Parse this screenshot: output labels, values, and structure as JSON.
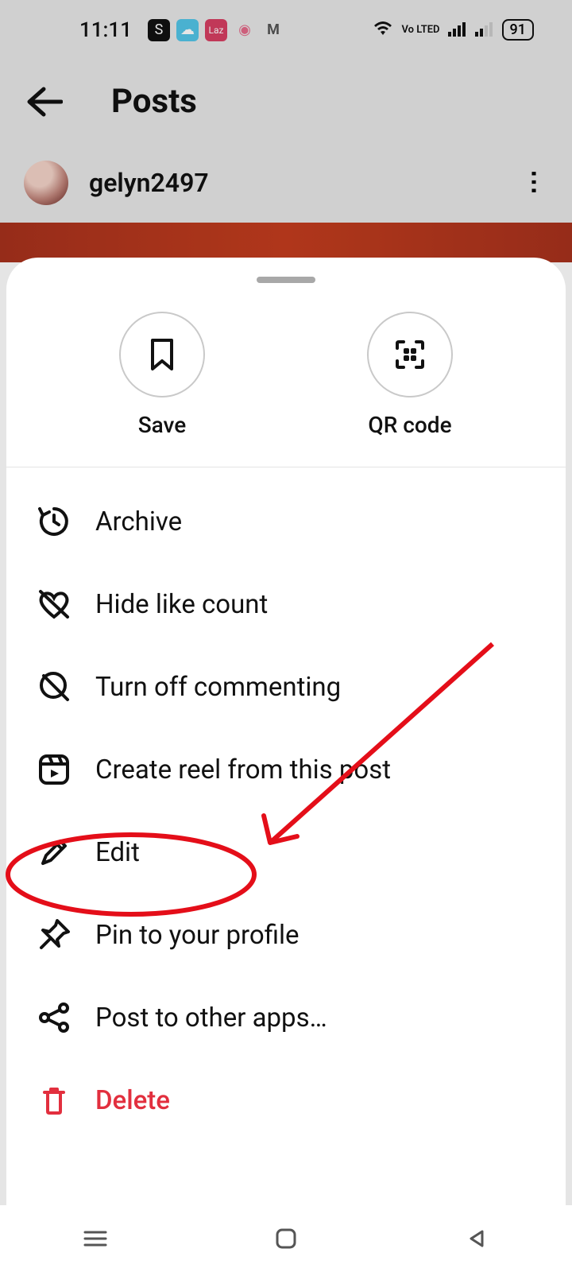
{
  "status": {
    "time": "11:11",
    "volte": "Vo LTED",
    "battery": "91"
  },
  "header": {
    "title": "Posts"
  },
  "user": {
    "name": "gelyn2497"
  },
  "sheet": {
    "top": [
      {
        "label": "Save"
      },
      {
        "label": "QR code"
      }
    ],
    "items": [
      {
        "label": "Archive"
      },
      {
        "label": "Hide like count"
      },
      {
        "label": "Turn off commenting"
      },
      {
        "label": "Create reel from this post"
      },
      {
        "label": "Edit"
      },
      {
        "label": "Pin to your profile"
      },
      {
        "label": "Post to other apps…"
      },
      {
        "label": "Delete"
      }
    ]
  }
}
